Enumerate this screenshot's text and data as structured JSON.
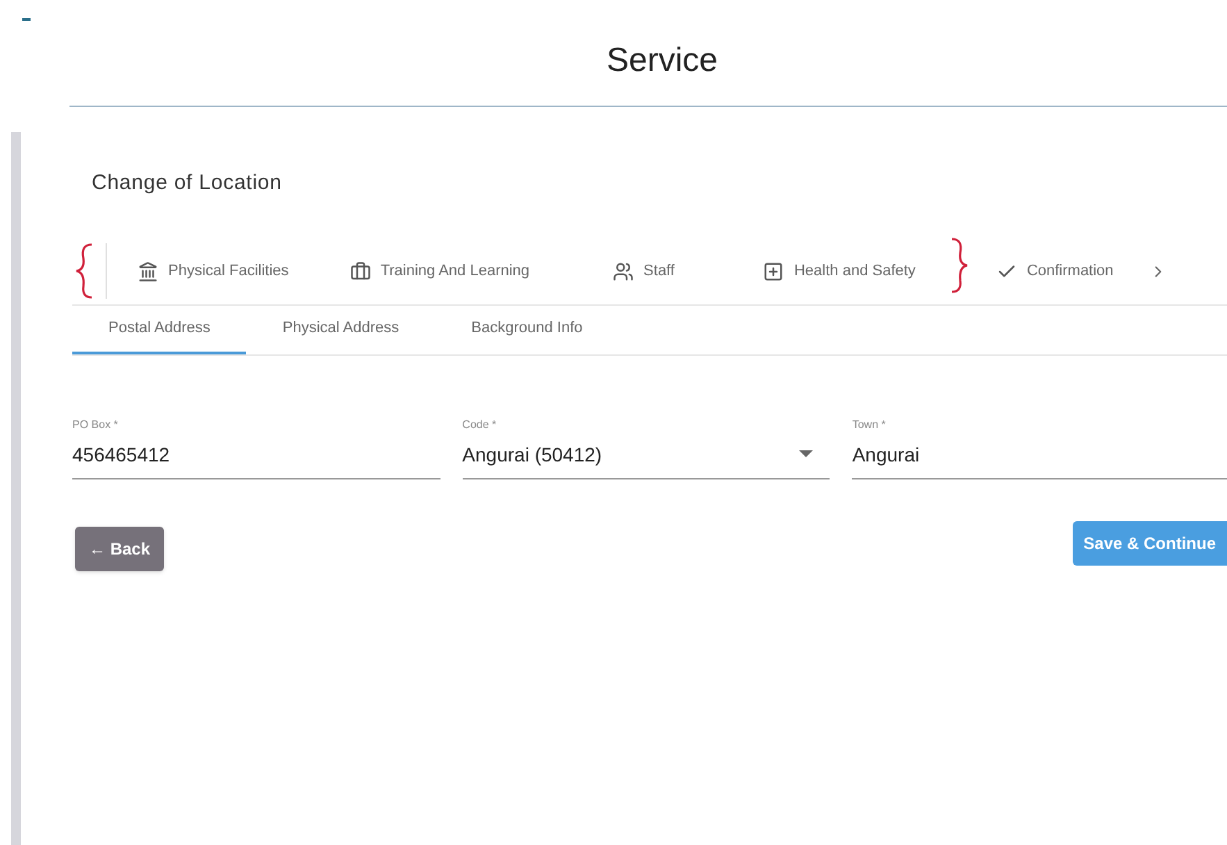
{
  "page": {
    "title": "Service"
  },
  "section": {
    "title": "Change of Location"
  },
  "steps": [
    {
      "label": "Physical Facilities"
    },
    {
      "label": "Training And Learning"
    },
    {
      "label": "Staff"
    },
    {
      "label": "Health and Safety"
    },
    {
      "label": "Confirmation"
    }
  ],
  "tabs": [
    {
      "label": "Postal Address",
      "selected": true
    },
    {
      "label": "Physical Address",
      "selected": false
    },
    {
      "label": "Background Info",
      "selected": false
    }
  ],
  "fields": [
    {
      "label": "PO Box *",
      "value": "456465412",
      "kind": "text"
    },
    {
      "label": "Code *",
      "value": "Angurai (50412)",
      "kind": "select"
    },
    {
      "label": "Town *",
      "value": "Angurai",
      "kind": "text"
    }
  ],
  "buttons": {
    "back": "← Back",
    "save": "Save & Continue"
  }
}
